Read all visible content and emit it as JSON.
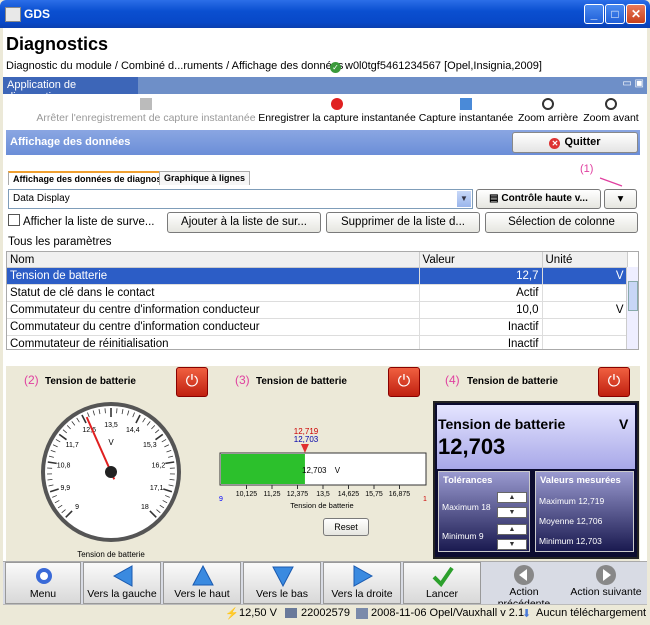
{
  "window": {
    "title": "GDS"
  },
  "header": {
    "title": "Diagnostics",
    "breadcrumb": "Diagnostic du module / Combiné d...ruments / Affichage des données",
    "vehicle": "w0l0tgf5461234567 [Opel,Insignia,2009]"
  },
  "app_tab": {
    "label": "Application de diagnostics"
  },
  "toolbar": {
    "stop_label": "Arrêter l'enregistrement de capture instantanée",
    "record_label": "Enregistrer la capture instantanée",
    "snapshot_label": "Capture instantanée",
    "zoom_out_label": "Zoom arrière",
    "zoom_in_label": "Zoom avant"
  },
  "section": {
    "title": "Affichage des données",
    "quit_label": "Quitter"
  },
  "subtabs": [
    "Affichage des données de diagnostic",
    "Graphique à lignes"
  ],
  "markers": {
    "m1": "(1)",
    "m2": "(2)",
    "m3": "(3)",
    "m4": "(4)"
  },
  "controls": {
    "display_select": "Data Display",
    "control_btn": "Contrôle haute v...",
    "show_watch_label": "Afficher la liste de surve...",
    "add_btn": "Ajouter à la liste de sur...",
    "remove_btn": "Supprimer de la liste d...",
    "columns_btn": "Sélection de colonne",
    "all_params": "Tous les paramètres"
  },
  "table": {
    "headers": [
      "Nom",
      "Valeur",
      "Unité"
    ],
    "rows": [
      [
        "Tension de batterie",
        "12,7",
        "V"
      ],
      [
        "Statut de clé dans le contact",
        "Actif",
        ""
      ],
      [
        "Commutateur du centre d'information conducteur",
        "10,0",
        "V"
      ],
      [
        "Commutateur du centre d'information conducteur",
        "Inactif",
        ""
      ],
      [
        "Commutateur de réinitialisation",
        "Inactif",
        ""
      ]
    ]
  },
  "gauge_analog": {
    "title": "Tension de batterie",
    "caption": "Tension de batterie",
    "unit": "V",
    "ticks": [
      "9",
      "9,9",
      "10,8",
      "11,7",
      "12,6",
      "13,5",
      "14,4",
      "15,3",
      "16,2",
      "17,1",
      "18"
    ],
    "value": 12.703,
    "min": 9,
    "max": 18
  },
  "gauge_bar": {
    "title": "Tension de batterie",
    "caption": "Tension de batterie",
    "max_marker": "12,719",
    "current_marker": "12,703",
    "value_text": "12,703",
    "unit": "V",
    "ticks": [
      "10,125",
      "11,25",
      "12,375",
      "13,5",
      "14,625",
      "15,75",
      "16,875"
    ],
    "value": 12.703,
    "min": 9,
    "max": 18,
    "end_left": "9",
    "end_right": "1",
    "reset_label": "Reset"
  },
  "gauge_digital": {
    "title": "Tension de batterie",
    "unit": "V",
    "value": "12,703",
    "tolerances_label": "Tolérances",
    "max_label": "Maximum 18",
    "min_label": "Minimum 9",
    "measured_label": "Valeurs mesurées",
    "measured": [
      "Maximum 12,719",
      "Moyenne 12,706",
      "Minimum 12,703"
    ]
  },
  "bottom_toolbar": {
    "menu": "Menu",
    "left": "Vers la gauche",
    "up": "Vers le haut",
    "down": "Vers le bas",
    "right": "Vers la droite",
    "launch": "Lancer",
    "prev": "Action précédente",
    "next": "Action suivante"
  },
  "status": {
    "voltage": "12,50 V",
    "device": "22002579",
    "version": "2008-11-06 Opel/Vauxhall v 2.1",
    "download": "Aucun téléchargement"
  },
  "colors": {
    "accent": "#2c5dc6",
    "marker": "#e040a0",
    "danger": "#d33020",
    "bar_fill": "#2cc02c"
  }
}
